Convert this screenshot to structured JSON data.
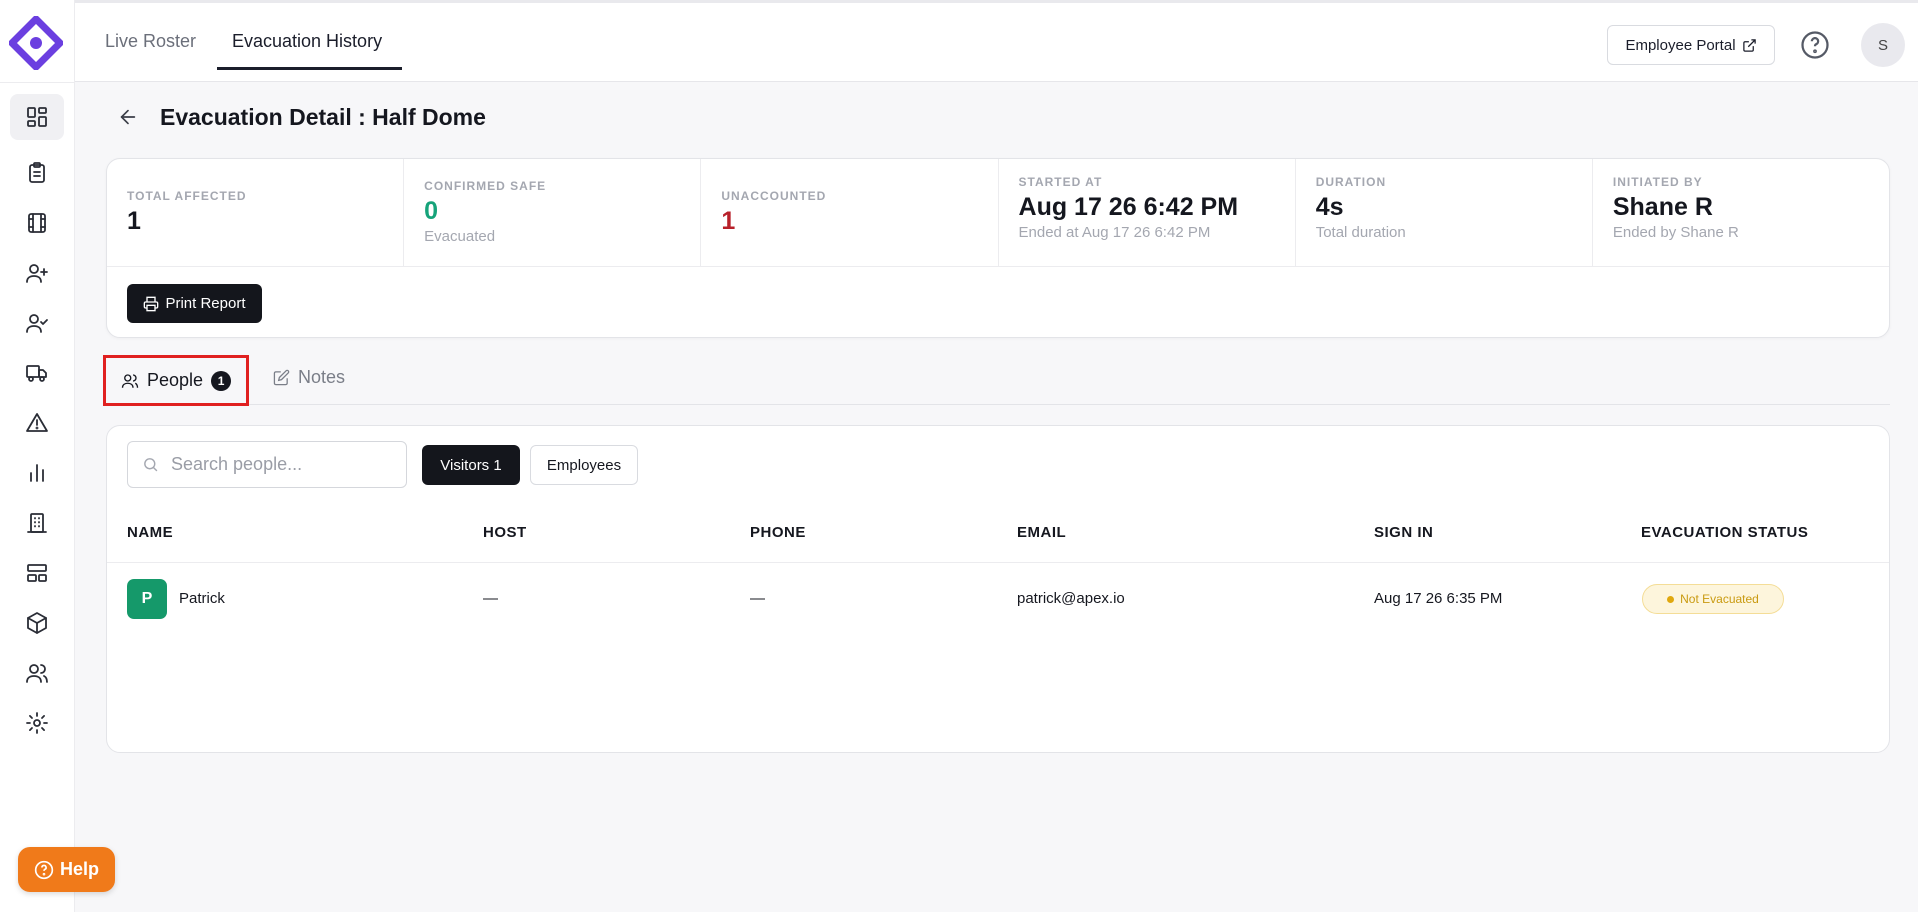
{
  "topbar": {
    "tabs": [
      {
        "label": "Live Roster"
      },
      {
        "label": "Evacuation History"
      }
    ],
    "portal_label": "Employee Portal",
    "avatar_initial": "S"
  },
  "sidebar": {
    "items": [
      {
        "icon": "dashboard-icon"
      },
      {
        "icon": "clipboard-icon"
      },
      {
        "icon": "film-icon"
      },
      {
        "icon": "user-plus-icon"
      },
      {
        "icon": "user-check-icon"
      },
      {
        "icon": "truck-icon"
      },
      {
        "icon": "alert-triangle-icon"
      },
      {
        "icon": "bar-chart-icon"
      },
      {
        "icon": "building-icon"
      },
      {
        "icon": "layout-icon"
      },
      {
        "icon": "box-icon"
      },
      {
        "icon": "users-icon"
      },
      {
        "icon": "settings-icon"
      }
    ],
    "help_label": "Help"
  },
  "page": {
    "title": "Evacuation Detail : Half Dome"
  },
  "stats": {
    "total_affected": {
      "label": "TOTAL AFFECTED",
      "value": "1"
    },
    "confirmed_safe": {
      "label": "CONFIRMED SAFE",
      "value": "0",
      "sub": "Evacuated"
    },
    "unaccounted": {
      "label": "UNACCOUNTED",
      "value": "1"
    },
    "started_at": {
      "label": "STARTED AT",
      "value": "Aug 17 26 6:42 PM",
      "sub": "Ended at Aug 17 26 6:42 PM"
    },
    "duration": {
      "label": "DURATION",
      "value": "4s",
      "sub": "Total duration"
    },
    "initiated_by": {
      "label": "INITIATED BY",
      "value": "Shane R",
      "sub": "Ended by Shane R"
    },
    "print_label": "Print Report"
  },
  "tabs": {
    "people": {
      "label": "People",
      "count": "1"
    },
    "notes": {
      "label": "Notes"
    }
  },
  "people": {
    "search_placeholder": "Search people...",
    "filters": {
      "visitors": "Visitors 1",
      "employees": "Employees"
    },
    "columns": [
      "NAME",
      "HOST",
      "PHONE",
      "EMAIL",
      "SIGN IN",
      "EVACUATION STATUS"
    ],
    "rows": [
      {
        "initial": "P",
        "name": "Patrick",
        "host": "—",
        "phone": "—",
        "email": "patrick@apex.io",
        "sign_in": "Aug 17 26 6:35 PM",
        "status": "Not Evacuated"
      }
    ]
  },
  "colors": {
    "brand": "#6b3fe0",
    "safe_green": "#16a37a",
    "unaccounted_red": "#b8202a",
    "help_orange": "#f07a1a",
    "status_pending": "#e0a80e"
  }
}
